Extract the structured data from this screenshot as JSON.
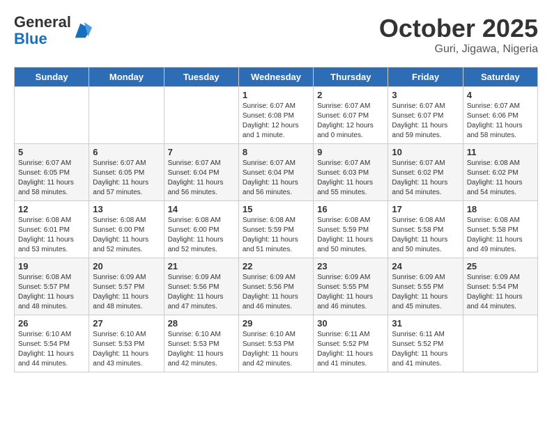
{
  "header": {
    "logo_general": "General",
    "logo_blue": "Blue",
    "month": "October 2025",
    "location": "Guri, Jigawa, Nigeria"
  },
  "weekdays": [
    "Sunday",
    "Monday",
    "Tuesday",
    "Wednesday",
    "Thursday",
    "Friday",
    "Saturday"
  ],
  "weeks": [
    [
      {
        "day": "",
        "info": ""
      },
      {
        "day": "",
        "info": ""
      },
      {
        "day": "",
        "info": ""
      },
      {
        "day": "1",
        "info": "Sunrise: 6:07 AM\nSunset: 6:08 PM\nDaylight: 12 hours\nand 1 minute."
      },
      {
        "day": "2",
        "info": "Sunrise: 6:07 AM\nSunset: 6:07 PM\nDaylight: 12 hours\nand 0 minutes."
      },
      {
        "day": "3",
        "info": "Sunrise: 6:07 AM\nSunset: 6:07 PM\nDaylight: 11 hours\nand 59 minutes."
      },
      {
        "day": "4",
        "info": "Sunrise: 6:07 AM\nSunset: 6:06 PM\nDaylight: 11 hours\nand 58 minutes."
      }
    ],
    [
      {
        "day": "5",
        "info": "Sunrise: 6:07 AM\nSunset: 6:05 PM\nDaylight: 11 hours\nand 58 minutes."
      },
      {
        "day": "6",
        "info": "Sunrise: 6:07 AM\nSunset: 6:05 PM\nDaylight: 11 hours\nand 57 minutes."
      },
      {
        "day": "7",
        "info": "Sunrise: 6:07 AM\nSunset: 6:04 PM\nDaylight: 11 hours\nand 56 minutes."
      },
      {
        "day": "8",
        "info": "Sunrise: 6:07 AM\nSunset: 6:04 PM\nDaylight: 11 hours\nand 56 minutes."
      },
      {
        "day": "9",
        "info": "Sunrise: 6:07 AM\nSunset: 6:03 PM\nDaylight: 11 hours\nand 55 minutes."
      },
      {
        "day": "10",
        "info": "Sunrise: 6:07 AM\nSunset: 6:02 PM\nDaylight: 11 hours\nand 54 minutes."
      },
      {
        "day": "11",
        "info": "Sunrise: 6:08 AM\nSunset: 6:02 PM\nDaylight: 11 hours\nand 54 minutes."
      }
    ],
    [
      {
        "day": "12",
        "info": "Sunrise: 6:08 AM\nSunset: 6:01 PM\nDaylight: 11 hours\nand 53 minutes."
      },
      {
        "day": "13",
        "info": "Sunrise: 6:08 AM\nSunset: 6:00 PM\nDaylight: 11 hours\nand 52 minutes."
      },
      {
        "day": "14",
        "info": "Sunrise: 6:08 AM\nSunset: 6:00 PM\nDaylight: 11 hours\nand 52 minutes."
      },
      {
        "day": "15",
        "info": "Sunrise: 6:08 AM\nSunset: 5:59 PM\nDaylight: 11 hours\nand 51 minutes."
      },
      {
        "day": "16",
        "info": "Sunrise: 6:08 AM\nSunset: 5:59 PM\nDaylight: 11 hours\nand 50 minutes."
      },
      {
        "day": "17",
        "info": "Sunrise: 6:08 AM\nSunset: 5:58 PM\nDaylight: 11 hours\nand 50 minutes."
      },
      {
        "day": "18",
        "info": "Sunrise: 6:08 AM\nSunset: 5:58 PM\nDaylight: 11 hours\nand 49 minutes."
      }
    ],
    [
      {
        "day": "19",
        "info": "Sunrise: 6:08 AM\nSunset: 5:57 PM\nDaylight: 11 hours\nand 48 minutes."
      },
      {
        "day": "20",
        "info": "Sunrise: 6:09 AM\nSunset: 5:57 PM\nDaylight: 11 hours\nand 48 minutes."
      },
      {
        "day": "21",
        "info": "Sunrise: 6:09 AM\nSunset: 5:56 PM\nDaylight: 11 hours\nand 47 minutes."
      },
      {
        "day": "22",
        "info": "Sunrise: 6:09 AM\nSunset: 5:56 PM\nDaylight: 11 hours\nand 46 minutes."
      },
      {
        "day": "23",
        "info": "Sunrise: 6:09 AM\nSunset: 5:55 PM\nDaylight: 11 hours\nand 46 minutes."
      },
      {
        "day": "24",
        "info": "Sunrise: 6:09 AM\nSunset: 5:55 PM\nDaylight: 11 hours\nand 45 minutes."
      },
      {
        "day": "25",
        "info": "Sunrise: 6:09 AM\nSunset: 5:54 PM\nDaylight: 11 hours\nand 44 minutes."
      }
    ],
    [
      {
        "day": "26",
        "info": "Sunrise: 6:10 AM\nSunset: 5:54 PM\nDaylight: 11 hours\nand 44 minutes."
      },
      {
        "day": "27",
        "info": "Sunrise: 6:10 AM\nSunset: 5:53 PM\nDaylight: 11 hours\nand 43 minutes."
      },
      {
        "day": "28",
        "info": "Sunrise: 6:10 AM\nSunset: 5:53 PM\nDaylight: 11 hours\nand 42 minutes."
      },
      {
        "day": "29",
        "info": "Sunrise: 6:10 AM\nSunset: 5:53 PM\nDaylight: 11 hours\nand 42 minutes."
      },
      {
        "day": "30",
        "info": "Sunrise: 6:11 AM\nSunset: 5:52 PM\nDaylight: 11 hours\nand 41 minutes."
      },
      {
        "day": "31",
        "info": "Sunrise: 6:11 AM\nSunset: 5:52 PM\nDaylight: 11 hours\nand 41 minutes."
      },
      {
        "day": "",
        "info": ""
      }
    ]
  ]
}
